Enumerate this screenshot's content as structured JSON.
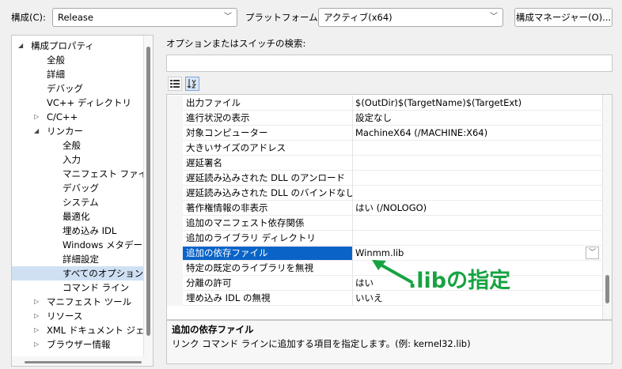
{
  "toolbar": {
    "config_label": "構成(C):",
    "config_value": "Release",
    "platform_label": "プラットフォーム(P):",
    "platform_value": "アクティブ(x64)",
    "config_manager_button": "構成マネージャー(O)..."
  },
  "tree": {
    "items": [
      {
        "label": "構成プロパティ",
        "level": 0,
        "expander": "expanded",
        "selected": false
      },
      {
        "label": "全般",
        "level": 1,
        "expander": "none",
        "selected": false
      },
      {
        "label": "詳細",
        "level": 1,
        "expander": "none",
        "selected": false
      },
      {
        "label": "デバッグ",
        "level": 1,
        "expander": "none",
        "selected": false
      },
      {
        "label": "VC++ ディレクトリ",
        "level": 1,
        "expander": "none",
        "selected": false
      },
      {
        "label": "C/C++",
        "level": 1,
        "expander": "collapsed",
        "selected": false
      },
      {
        "label": "リンカー",
        "level": 1,
        "expander": "expanded",
        "selected": false
      },
      {
        "label": "全般",
        "level": 2,
        "expander": "none",
        "selected": false
      },
      {
        "label": "入力",
        "level": 2,
        "expander": "none",
        "selected": false
      },
      {
        "label": "マニフェスト ファイル",
        "level": 2,
        "expander": "none",
        "selected": false
      },
      {
        "label": "デバッグ",
        "level": 2,
        "expander": "none",
        "selected": false
      },
      {
        "label": "システム",
        "level": 2,
        "expander": "none",
        "selected": false
      },
      {
        "label": "最適化",
        "level": 2,
        "expander": "none",
        "selected": false
      },
      {
        "label": "埋め込み IDL",
        "level": 2,
        "expander": "none",
        "selected": false
      },
      {
        "label": "Windows メタデータ",
        "level": 2,
        "expander": "none",
        "selected": false
      },
      {
        "label": "詳細設定",
        "level": 2,
        "expander": "none",
        "selected": false
      },
      {
        "label": "すべてのオプション",
        "level": 2,
        "expander": "none",
        "selected": true
      },
      {
        "label": "コマンド ライン",
        "level": 2,
        "expander": "none",
        "selected": false
      },
      {
        "label": "マニフェスト ツール",
        "level": 1,
        "expander": "collapsed",
        "selected": false
      },
      {
        "label": "リソース",
        "level": 1,
        "expander": "collapsed",
        "selected": false
      },
      {
        "label": "XML ドキュメント ジェネレー",
        "level": 1,
        "expander": "collapsed",
        "selected": false
      },
      {
        "label": "ブラウザー情報",
        "level": 1,
        "expander": "collapsed",
        "selected": false
      }
    ]
  },
  "search": {
    "label": "オプションまたはスイッチの検索:",
    "value": ""
  },
  "view_buttons": [
    {
      "icon": "categorized-icon",
      "active": false
    },
    {
      "icon": "sort-alphabetical-icon",
      "active": true
    }
  ],
  "properties": [
    {
      "name": "出力ファイル",
      "value": "$(OutDir)$(TargetName)$(TargetExt)",
      "selected": false
    },
    {
      "name": "進行状況の表示",
      "value": "設定なし",
      "selected": false
    },
    {
      "name": "対象コンピューター",
      "value": "MachineX64 (/MACHINE:X64)",
      "selected": false
    },
    {
      "name": "大きいサイズのアドレス",
      "value": "",
      "selected": false
    },
    {
      "name": "遅延署名",
      "value": "",
      "selected": false
    },
    {
      "name": "遅延読み込みされた DLL のアンロード",
      "value": "",
      "selected": false
    },
    {
      "name": "遅延読み込みされた DLL のバインドなし",
      "value": "",
      "selected": false
    },
    {
      "name": "著作権情報の非表示",
      "value": "はい (/NOLOGO)",
      "selected": false
    },
    {
      "name": "追加のマニフェスト依存関係",
      "value": "",
      "selected": false
    },
    {
      "name": "追加のライブラリ ディレクトリ",
      "value": "",
      "selected": false
    },
    {
      "name": "追加の依存ファイル",
      "value": "Winmm.lib",
      "selected": true
    },
    {
      "name": "特定の既定のライブラリを無視",
      "value": "",
      "selected": false
    },
    {
      "name": "分離の許可",
      "value": "はい",
      "selected": false
    },
    {
      "name": "埋め込み IDL の無視",
      "value": "いいえ",
      "selected": false
    }
  ],
  "description": {
    "title": "追加の依存ファイル",
    "body": "リンク コマンド ラインに追加する項目を指定します。(例: kernel32.lib)"
  },
  "annotation": {
    "text": ".libの指定",
    "color": "#17a343"
  },
  "colors": {
    "selection": "#0a64c8",
    "tree_selection": "#cfe0f3"
  }
}
